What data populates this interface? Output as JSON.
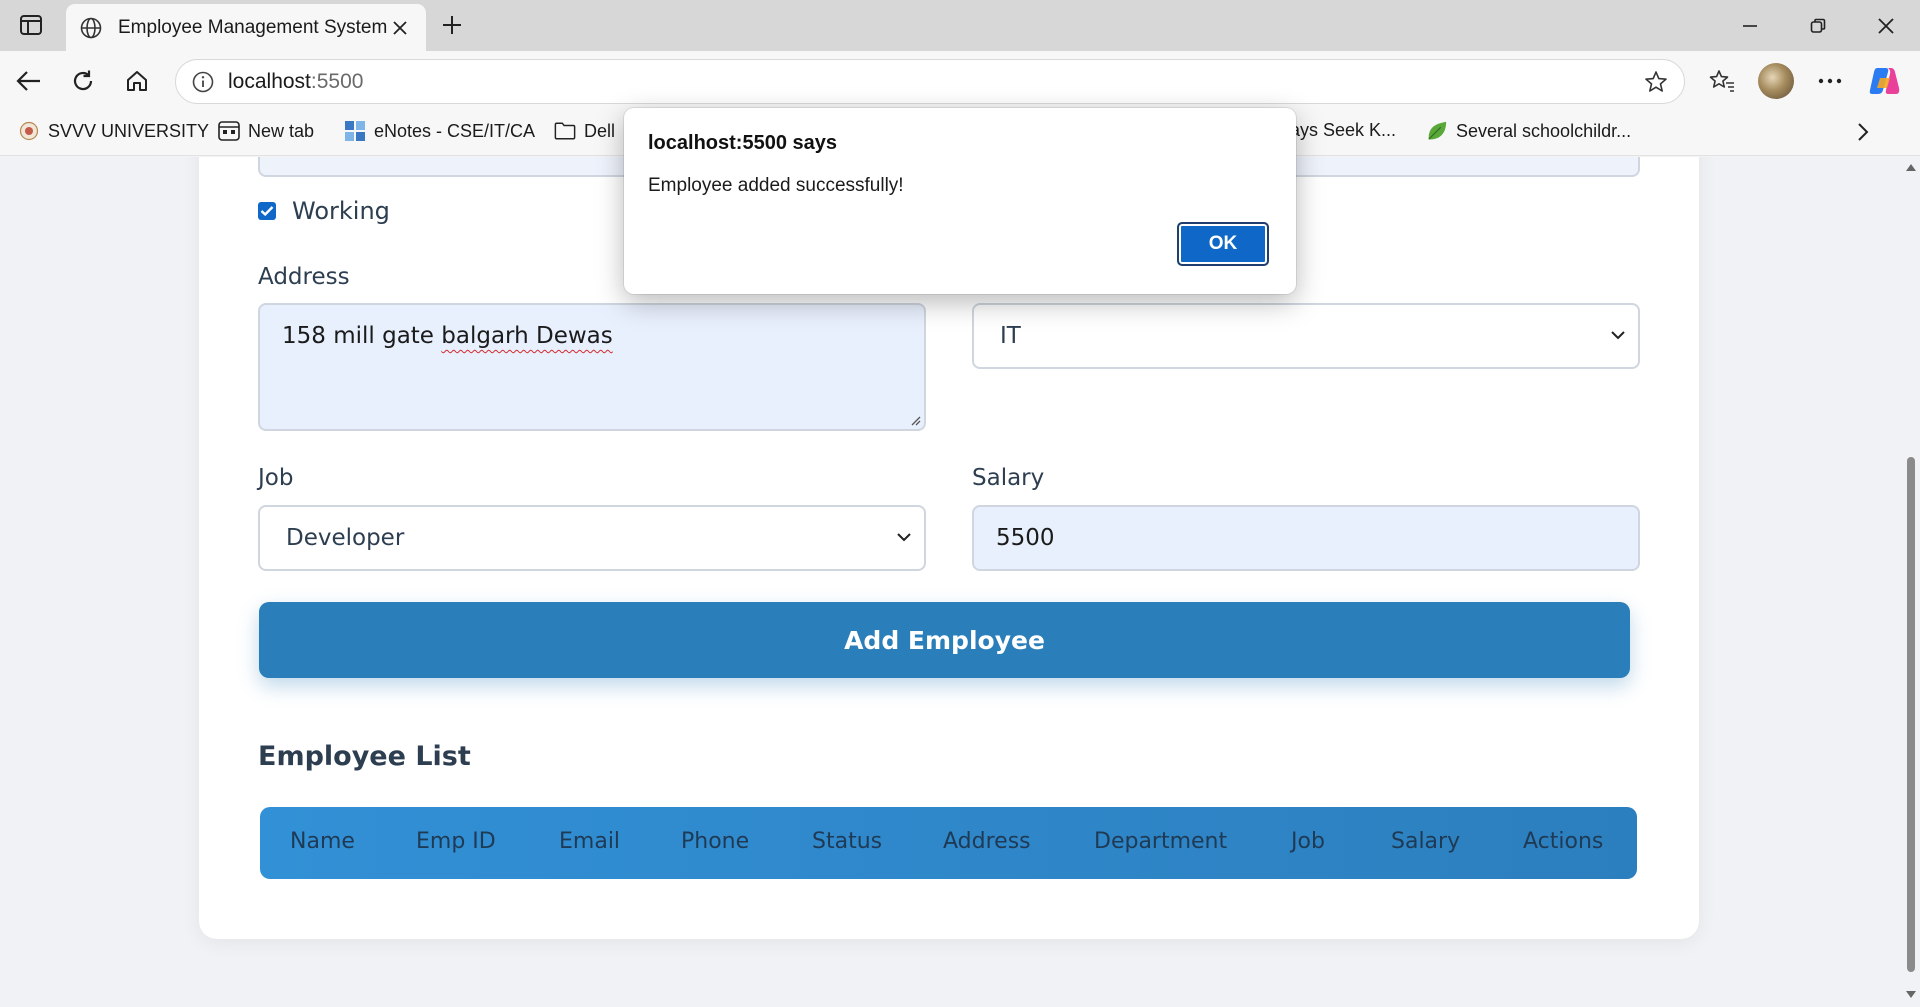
{
  "browser": {
    "tab_title": "Employee Management System",
    "url_host": "localhost",
    "url_port": ":5500"
  },
  "bookmarks": [
    {
      "label": "SVVV UNIVERSITY"
    },
    {
      "label": "New tab"
    },
    {
      "label": "eNotes - CSE/IT/CA"
    },
    {
      "label": "Dell"
    },
    {
      "label": "ays Seek K..."
    },
    {
      "label": "Several schoolchildr..."
    }
  ],
  "form": {
    "working_label": "Working",
    "working_checked": true,
    "address_label": "Address",
    "address_value_plain": "158 mill gate ",
    "address_value_flagged": "balgarh Dewas",
    "department_value": "IT",
    "job_label": "Job",
    "job_value": "Developer",
    "salary_label": "Salary",
    "salary_value": "5500",
    "submit_label": "Add Employee"
  },
  "employee_list": {
    "title": "Employee List",
    "columns": [
      "Name",
      "Emp ID",
      "Email",
      "Phone",
      "Status",
      "Address",
      "Department",
      "Job",
      "Salary",
      "Actions"
    ]
  },
  "dialog": {
    "title": "localhost:5500 says",
    "message": "Employee added successfully!",
    "ok_label": "OK"
  },
  "colors": {
    "primary_button": "#2a7fba",
    "table_header": "#3290d6",
    "dialog_ok": "#0f68c8"
  }
}
